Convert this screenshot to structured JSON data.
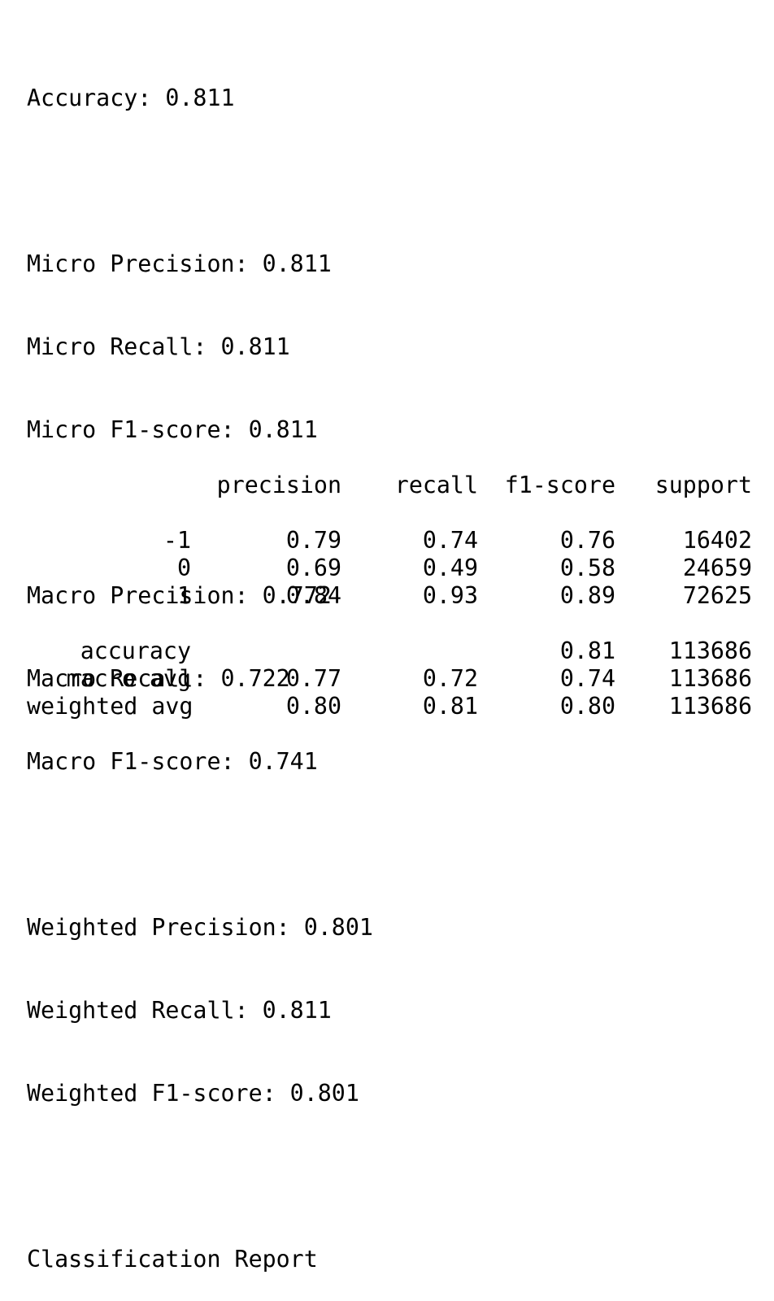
{
  "accuracy_line": "Accuracy: 0.811",
  "micro": {
    "precision": "Micro Precision: 0.811",
    "recall": "Micro Recall: 0.811",
    "f1": "Micro F1-score: 0.811"
  },
  "macro": {
    "precision": "Macro Precision: 0.772",
    "recall": "Macro Recall: 0.722",
    "f1": "Macro F1-score: 0.741"
  },
  "weighted": {
    "precision": "Weighted Precision: 0.801",
    "recall": "Weighted Recall: 0.811",
    "f1": "Weighted F1-score: 0.801"
  },
  "report": {
    "title": "Classification Report",
    "headers": {
      "precision": "precision",
      "recall": "recall",
      "f1": "f1-score",
      "support": "support"
    },
    "class_rows": [
      {
        "label": "-1",
        "precision": "0.79",
        "recall": "0.74",
        "f1": "0.76",
        "support": "16402"
      },
      {
        "label": "0",
        "precision": "0.69",
        "recall": "0.49",
        "f1": "0.58",
        "support": "24659"
      },
      {
        "label": "1",
        "precision": "0.84",
        "recall": "0.93",
        "f1": "0.89",
        "support": "72625"
      }
    ],
    "summary_rows": [
      {
        "label": "accuracy",
        "precision": "",
        "recall": "",
        "f1": "0.81",
        "support": "113686"
      },
      {
        "label": "macro avg",
        "precision": "0.77",
        "recall": "0.72",
        "f1": "0.74",
        "support": "113686"
      },
      {
        "label": "weighted avg",
        "precision": "0.80",
        "recall": "0.81",
        "f1": "0.80",
        "support": "113686"
      }
    ]
  }
}
